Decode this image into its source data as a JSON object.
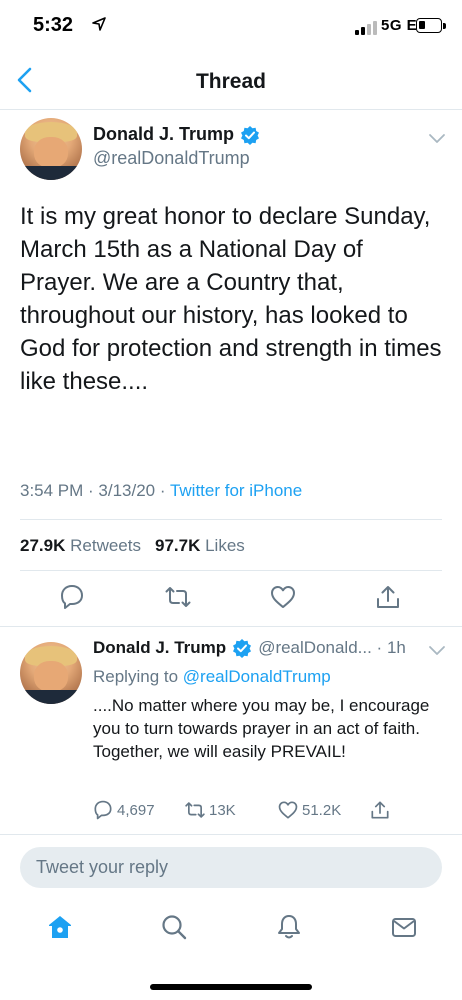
{
  "status_bar": {
    "time": "5:32",
    "location_icon": "location-arrow-icon",
    "network": "5G E",
    "signal_icon": "cellular-signal-icon",
    "battery_icon": "battery-icon"
  },
  "nav": {
    "back_icon": "chevron-left-icon",
    "title": "Thread"
  },
  "main_tweet": {
    "author_name": "Donald J. Trump",
    "handle": "@realDonaldTrump",
    "verified_icon": "verified-badge-icon",
    "text": "It is my great honor to declare Sunday, March 15th as a National Day of Prayer. We are a Country that, throughout our history, has looked to God for protection and strength in times like these....",
    "timestamp": "3:54 PM · 3/13/20 · ",
    "source": "Twitter for iPhone",
    "retweets_count": "27.9K",
    "retweets_label": "Retweets",
    "likes_count": "97.7K",
    "likes_label": "Likes",
    "actions": [
      "reply-icon",
      "retweet-icon",
      "like-heart-icon",
      "share-icon"
    ]
  },
  "reply_tweet": {
    "author_name": "Donald J. Trump",
    "handle_time": "@realDonald... · 1h",
    "replying_to_label": "Replying to",
    "replying_to_handle": "@realDonaldTrump",
    "text": "....No matter where you may be, I encourage you to turn towards prayer in an act of faith. Together, we will easily PREVAIL!",
    "reply_count": "4,697",
    "retweet_count": "13K",
    "like_count": "51.2K"
  },
  "reply_input": {
    "placeholder": "Tweet your reply"
  },
  "tab_bar": [
    "home-icon",
    "search-icon",
    "notifications-bell-icon",
    "messages-envelope-icon"
  ],
  "colors": {
    "accent": "#1da1f2",
    "text_primary": "#14171a",
    "text_secondary": "#657786",
    "divider": "#e1e8ed",
    "input_bg": "#e6ecf0"
  }
}
